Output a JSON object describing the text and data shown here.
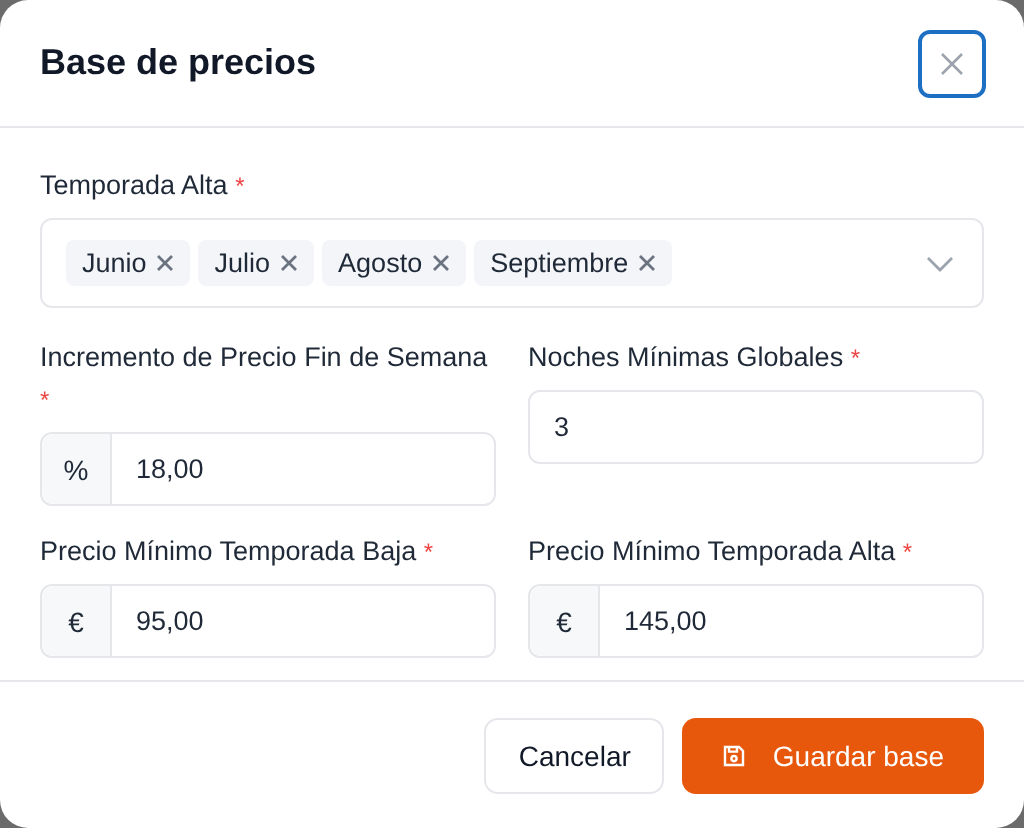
{
  "dialog": {
    "title": "Base de precios"
  },
  "season_field": {
    "label": "Temporada Alta",
    "mark": "*",
    "tags": [
      "Junio",
      "Julio",
      "Agosto",
      "Septiembre"
    ]
  },
  "fields": [
    {
      "label": "Incremento de Precio Fin de Semana",
      "mark": "*",
      "prefix": "%",
      "value": "18,00"
    },
    {
      "label": "Noches Mínimas Globales",
      "mark": "*",
      "value": "3"
    },
    {
      "label": "Precio Mínimo Temporada Baja",
      "mark": "*",
      "prefix": "€",
      "value": "95,00"
    },
    {
      "label": "Precio Mínimo Temporada Alta",
      "mark": "*",
      "prefix": "€",
      "value": "145,00"
    }
  ],
  "buttons": [
    {
      "label": "Cancelar",
      "kind": "secondary"
    },
    {
      "label": "Guardar base",
      "kind": "primary"
    }
  ]
}
